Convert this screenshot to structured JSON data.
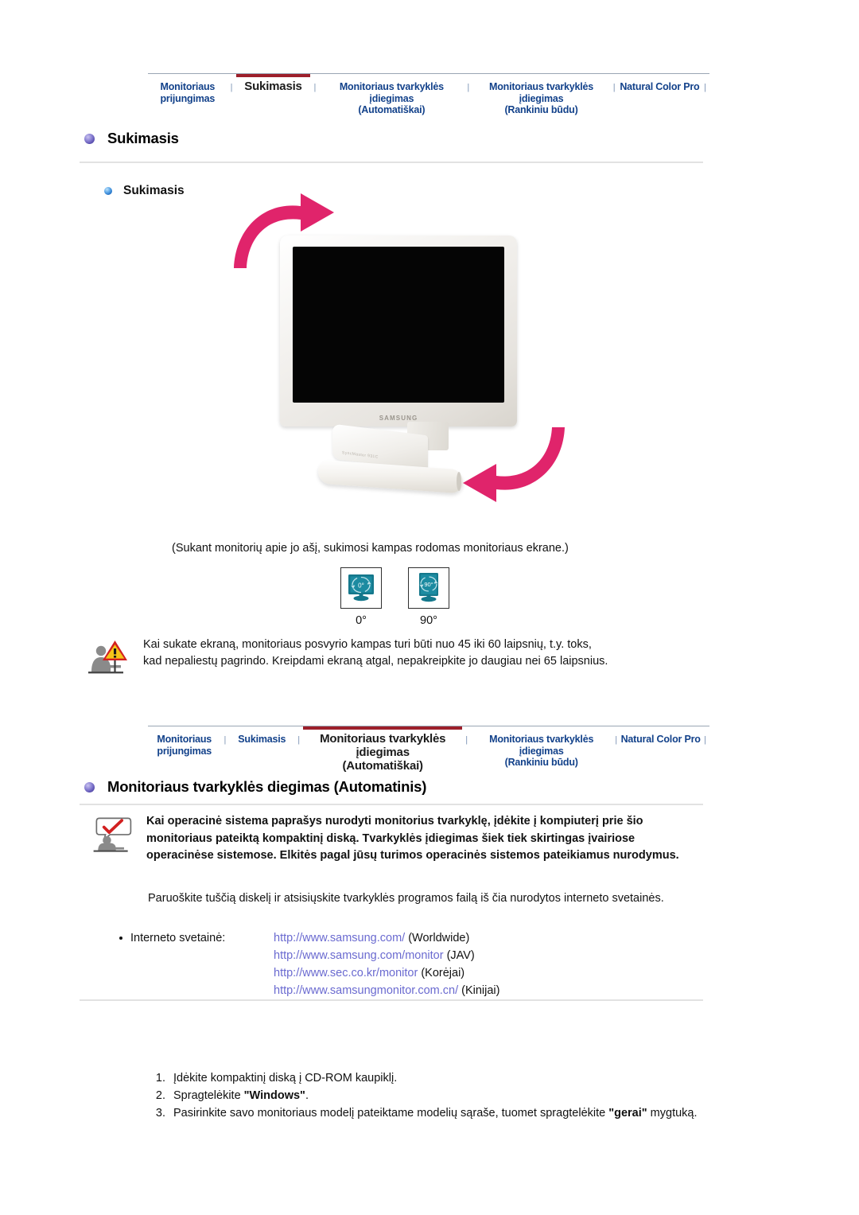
{
  "nav_top": {
    "items": [
      {
        "label": "Monitoriaus\nprijungimas",
        "active": false
      },
      {
        "label": "Sukimasis",
        "active": true
      },
      {
        "label": "Monitoriaus tvarkyklės įdiegimas\n(Automatiškai)",
        "active": false
      },
      {
        "label": "Monitoriaus tvarkyklės įdiegimas\n(Rankiniu būdu)",
        "active": false
      },
      {
        "label": "Natural Color Pro",
        "active": false
      }
    ],
    "separator": "|"
  },
  "nav_mid": {
    "items": [
      {
        "label": "Monitoriaus\nprijungimas",
        "active": false
      },
      {
        "label": "Sukimasis",
        "active": false
      },
      {
        "label": "Monitoriaus tvarkyklės įdiegimas\n(Automatiškai)",
        "active": true
      },
      {
        "label": "Monitoriaus tvarkyklės įdiegimas\n(Rankiniu būdu)",
        "active": false
      },
      {
        "label": "Natural Color Pro",
        "active": false
      }
    ],
    "separator": "|"
  },
  "section1": {
    "title": "Sukimasis",
    "subtitle": "Sukimasis",
    "caption": "(Sukant monitorių apie jo ašį, sukimosi kampas rodomas monitoriaus ekrane.)",
    "monitor_logo": "SAMSUNG",
    "monitor_arm_label": "SyncMaster 931C",
    "rotation_icons": [
      {
        "icon_text": "0°",
        "label": "0°",
        "orientation": "landscape"
      },
      {
        "icon_text": "90°",
        "label": "90°",
        "orientation": "portrait"
      }
    ],
    "warning": {
      "line1": "Kai sukate ekraną, monitoriaus posvyrio kampas turi būti nuo 45 iki 60 laipsnių, t.y. toks,",
      "line2": "kad nepaliestų pagrindo. Kreipdami ekraną atgal, nepakreipkite jo daugiau nei 65 laipsnius."
    }
  },
  "section2": {
    "title": "Monitoriaus tvarkyklės diegimas (Automatinis)",
    "note": "Kai operacinė sistema paprašys nurodyti monitorius tvarkyklę, įdėkite į kompiuterį prie šio monitoriaus pateiktą kompaktinį diską. Tvarkyklės įdiegimas šiek tiek skirtingas įvairiose operacinėse sistemose. Elkitės pagal jūsų turimos operacinės sistemos pateikiamus nurodymus.",
    "paragraph": "Paruoškite tuščią diskelį ir atsisiųskite tvarkyklės programos failą iš čia nurodytos interneto svetainės.",
    "url_label": "Interneto svetainė:",
    "urls": [
      {
        "url": "http://www.samsung.com/",
        "region": " (Worldwide)"
      },
      {
        "url": "http://www.samsung.com/monitor",
        "region": " (JAV)"
      },
      {
        "url": "http://www.sec.co.kr/monitor",
        "region": " (Korėjai)"
      },
      {
        "url": "http://www.samsungmonitor.com.cn/",
        "region": " (Kinijai)"
      }
    ],
    "steps": [
      {
        "num": "1.",
        "pre": "Įdėkite kompaktinį diską į CD-ROM kaupiklį.",
        "bold": "",
        "post": ""
      },
      {
        "num": "2.",
        "pre": "Spragtelėkite ",
        "bold": "\"Windows\"",
        "post": "."
      },
      {
        "num": "3.",
        "pre": "Pasirinkite savo monitoriaus modelį pateiktame modelių sąraše, tuomet spragtelėkite ",
        "bold": "\"gerai\"",
        "post": " mygtuką."
      }
    ]
  },
  "colors": {
    "nav_link": "#12418a",
    "nav_active_bar": "#9d1f2b",
    "nav_active_text": "#1b1b1b",
    "link": "#6a6ad0",
    "arrow": "#e0246b",
    "rot_icon": "#15788c",
    "warn_triangle": "#f5c518",
    "warn_border": "#d22020",
    "person": "#8a8a8a"
  }
}
